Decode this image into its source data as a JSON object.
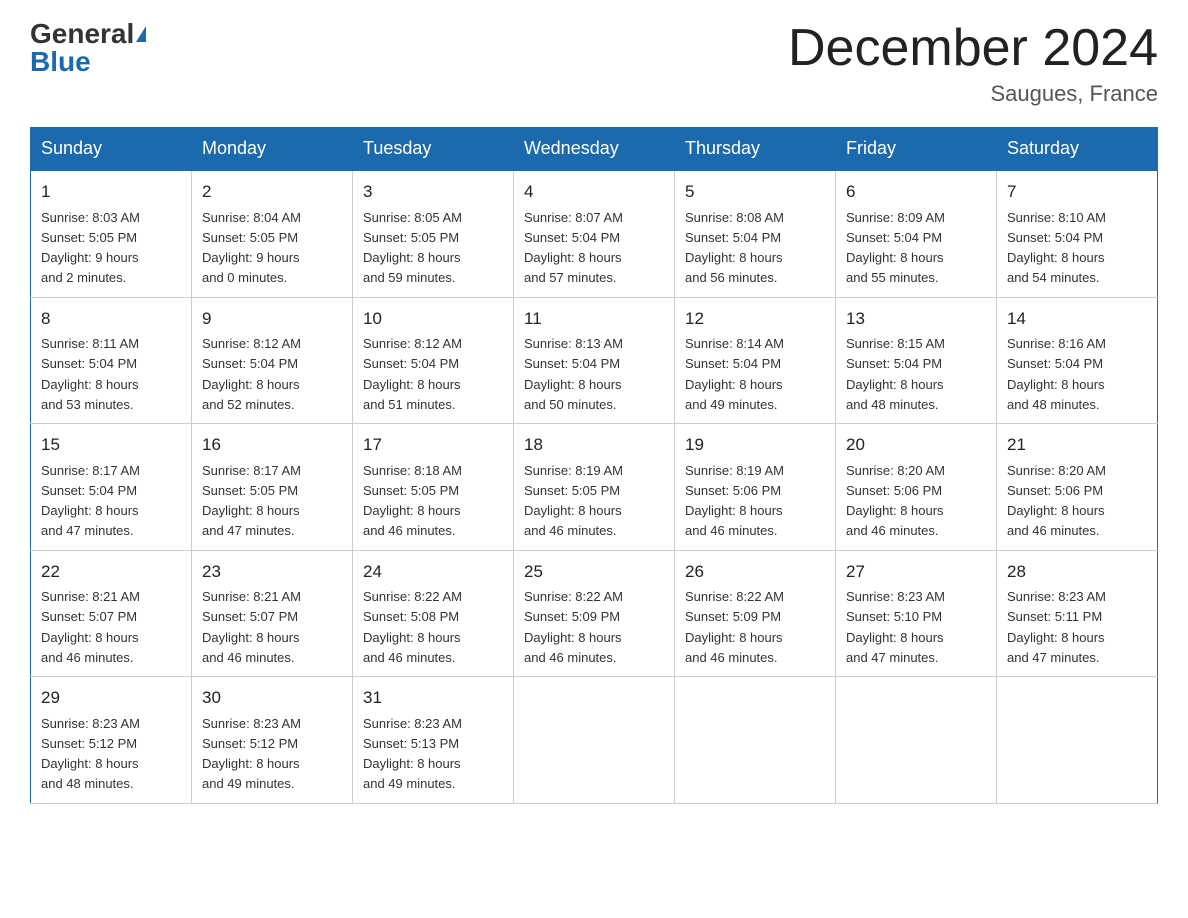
{
  "header": {
    "logo_general": "General",
    "logo_blue": "Blue",
    "month_title": "December 2024",
    "location": "Saugues, France"
  },
  "days_of_week": [
    "Sunday",
    "Monday",
    "Tuesday",
    "Wednesday",
    "Thursday",
    "Friday",
    "Saturday"
  ],
  "weeks": [
    [
      {
        "day": "1",
        "sunrise": "Sunrise: 8:03 AM",
        "sunset": "Sunset: 5:05 PM",
        "daylight": "Daylight: 9 hours",
        "daylight2": "and 2 minutes."
      },
      {
        "day": "2",
        "sunrise": "Sunrise: 8:04 AM",
        "sunset": "Sunset: 5:05 PM",
        "daylight": "Daylight: 9 hours",
        "daylight2": "and 0 minutes."
      },
      {
        "day": "3",
        "sunrise": "Sunrise: 8:05 AM",
        "sunset": "Sunset: 5:05 PM",
        "daylight": "Daylight: 8 hours",
        "daylight2": "and 59 minutes."
      },
      {
        "day": "4",
        "sunrise": "Sunrise: 8:07 AM",
        "sunset": "Sunset: 5:04 PM",
        "daylight": "Daylight: 8 hours",
        "daylight2": "and 57 minutes."
      },
      {
        "day": "5",
        "sunrise": "Sunrise: 8:08 AM",
        "sunset": "Sunset: 5:04 PM",
        "daylight": "Daylight: 8 hours",
        "daylight2": "and 56 minutes."
      },
      {
        "day": "6",
        "sunrise": "Sunrise: 8:09 AM",
        "sunset": "Sunset: 5:04 PM",
        "daylight": "Daylight: 8 hours",
        "daylight2": "and 55 minutes."
      },
      {
        "day": "7",
        "sunrise": "Sunrise: 8:10 AM",
        "sunset": "Sunset: 5:04 PM",
        "daylight": "Daylight: 8 hours",
        "daylight2": "and 54 minutes."
      }
    ],
    [
      {
        "day": "8",
        "sunrise": "Sunrise: 8:11 AM",
        "sunset": "Sunset: 5:04 PM",
        "daylight": "Daylight: 8 hours",
        "daylight2": "and 53 minutes."
      },
      {
        "day": "9",
        "sunrise": "Sunrise: 8:12 AM",
        "sunset": "Sunset: 5:04 PM",
        "daylight": "Daylight: 8 hours",
        "daylight2": "and 52 minutes."
      },
      {
        "day": "10",
        "sunrise": "Sunrise: 8:12 AM",
        "sunset": "Sunset: 5:04 PM",
        "daylight": "Daylight: 8 hours",
        "daylight2": "and 51 minutes."
      },
      {
        "day": "11",
        "sunrise": "Sunrise: 8:13 AM",
        "sunset": "Sunset: 5:04 PM",
        "daylight": "Daylight: 8 hours",
        "daylight2": "and 50 minutes."
      },
      {
        "day": "12",
        "sunrise": "Sunrise: 8:14 AM",
        "sunset": "Sunset: 5:04 PM",
        "daylight": "Daylight: 8 hours",
        "daylight2": "and 49 minutes."
      },
      {
        "day": "13",
        "sunrise": "Sunrise: 8:15 AM",
        "sunset": "Sunset: 5:04 PM",
        "daylight": "Daylight: 8 hours",
        "daylight2": "and 48 minutes."
      },
      {
        "day": "14",
        "sunrise": "Sunrise: 8:16 AM",
        "sunset": "Sunset: 5:04 PM",
        "daylight": "Daylight: 8 hours",
        "daylight2": "and 48 minutes."
      }
    ],
    [
      {
        "day": "15",
        "sunrise": "Sunrise: 8:17 AM",
        "sunset": "Sunset: 5:04 PM",
        "daylight": "Daylight: 8 hours",
        "daylight2": "and 47 minutes."
      },
      {
        "day": "16",
        "sunrise": "Sunrise: 8:17 AM",
        "sunset": "Sunset: 5:05 PM",
        "daylight": "Daylight: 8 hours",
        "daylight2": "and 47 minutes."
      },
      {
        "day": "17",
        "sunrise": "Sunrise: 8:18 AM",
        "sunset": "Sunset: 5:05 PM",
        "daylight": "Daylight: 8 hours",
        "daylight2": "and 46 minutes."
      },
      {
        "day": "18",
        "sunrise": "Sunrise: 8:19 AM",
        "sunset": "Sunset: 5:05 PM",
        "daylight": "Daylight: 8 hours",
        "daylight2": "and 46 minutes."
      },
      {
        "day": "19",
        "sunrise": "Sunrise: 8:19 AM",
        "sunset": "Sunset: 5:06 PM",
        "daylight": "Daylight: 8 hours",
        "daylight2": "and 46 minutes."
      },
      {
        "day": "20",
        "sunrise": "Sunrise: 8:20 AM",
        "sunset": "Sunset: 5:06 PM",
        "daylight": "Daylight: 8 hours",
        "daylight2": "and 46 minutes."
      },
      {
        "day": "21",
        "sunrise": "Sunrise: 8:20 AM",
        "sunset": "Sunset: 5:06 PM",
        "daylight": "Daylight: 8 hours",
        "daylight2": "and 46 minutes."
      }
    ],
    [
      {
        "day": "22",
        "sunrise": "Sunrise: 8:21 AM",
        "sunset": "Sunset: 5:07 PM",
        "daylight": "Daylight: 8 hours",
        "daylight2": "and 46 minutes."
      },
      {
        "day": "23",
        "sunrise": "Sunrise: 8:21 AM",
        "sunset": "Sunset: 5:07 PM",
        "daylight": "Daylight: 8 hours",
        "daylight2": "and 46 minutes."
      },
      {
        "day": "24",
        "sunrise": "Sunrise: 8:22 AM",
        "sunset": "Sunset: 5:08 PM",
        "daylight": "Daylight: 8 hours",
        "daylight2": "and 46 minutes."
      },
      {
        "day": "25",
        "sunrise": "Sunrise: 8:22 AM",
        "sunset": "Sunset: 5:09 PM",
        "daylight": "Daylight: 8 hours",
        "daylight2": "and 46 minutes."
      },
      {
        "day": "26",
        "sunrise": "Sunrise: 8:22 AM",
        "sunset": "Sunset: 5:09 PM",
        "daylight": "Daylight: 8 hours",
        "daylight2": "and 46 minutes."
      },
      {
        "day": "27",
        "sunrise": "Sunrise: 8:23 AM",
        "sunset": "Sunset: 5:10 PM",
        "daylight": "Daylight: 8 hours",
        "daylight2": "and 47 minutes."
      },
      {
        "day": "28",
        "sunrise": "Sunrise: 8:23 AM",
        "sunset": "Sunset: 5:11 PM",
        "daylight": "Daylight: 8 hours",
        "daylight2": "and 47 minutes."
      }
    ],
    [
      {
        "day": "29",
        "sunrise": "Sunrise: 8:23 AM",
        "sunset": "Sunset: 5:12 PM",
        "daylight": "Daylight: 8 hours",
        "daylight2": "and 48 minutes."
      },
      {
        "day": "30",
        "sunrise": "Sunrise: 8:23 AM",
        "sunset": "Sunset: 5:12 PM",
        "daylight": "Daylight: 8 hours",
        "daylight2": "and 49 minutes."
      },
      {
        "day": "31",
        "sunrise": "Sunrise: 8:23 AM",
        "sunset": "Sunset: 5:13 PM",
        "daylight": "Daylight: 8 hours",
        "daylight2": "and 49 minutes."
      },
      null,
      null,
      null,
      null
    ]
  ]
}
